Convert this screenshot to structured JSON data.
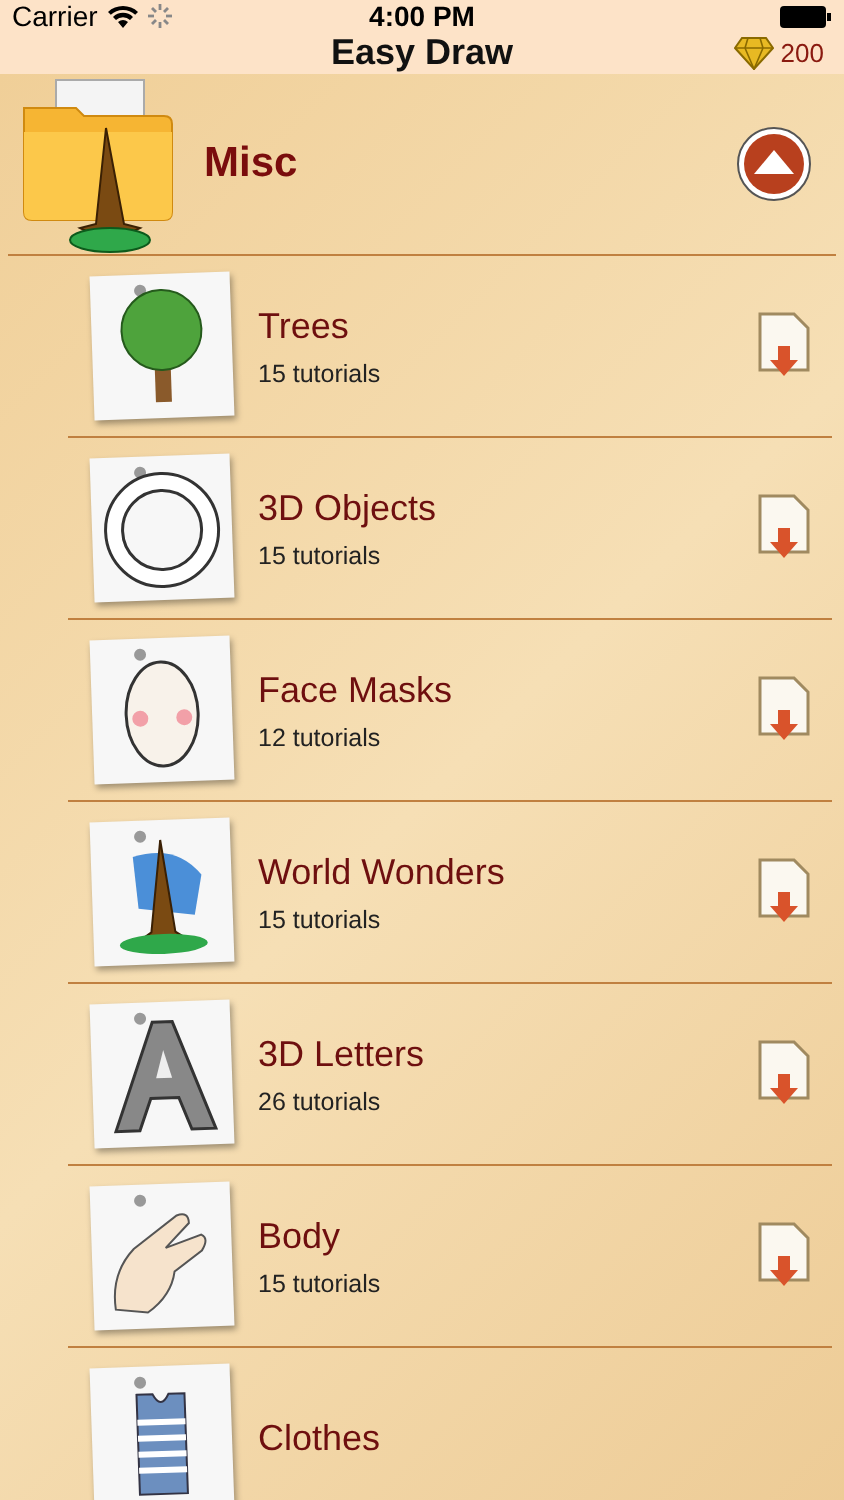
{
  "status_bar": {
    "carrier": "Carrier",
    "time": "4:00 PM"
  },
  "nav": {
    "title": "Easy Draw",
    "gems": "200"
  },
  "category": {
    "title": "Misc",
    "expanded": true
  },
  "items": [
    {
      "title": "Trees",
      "subtitle": "15 tutorials",
      "kind": "tree"
    },
    {
      "title": "3D Objects",
      "subtitle": "15 tutorials",
      "kind": "ring"
    },
    {
      "title": "Face Masks",
      "subtitle": "12 tutorials",
      "kind": "mask"
    },
    {
      "title": "World Wonders",
      "subtitle": "15 tutorials",
      "kind": "tower"
    },
    {
      "title": "3D Letters",
      "subtitle": "26 tutorials",
      "kind": "letter"
    },
    {
      "title": "Body",
      "subtitle": "15 tutorials",
      "kind": "hand"
    },
    {
      "title": "Clothes",
      "kind": "shirt"
    }
  ]
}
